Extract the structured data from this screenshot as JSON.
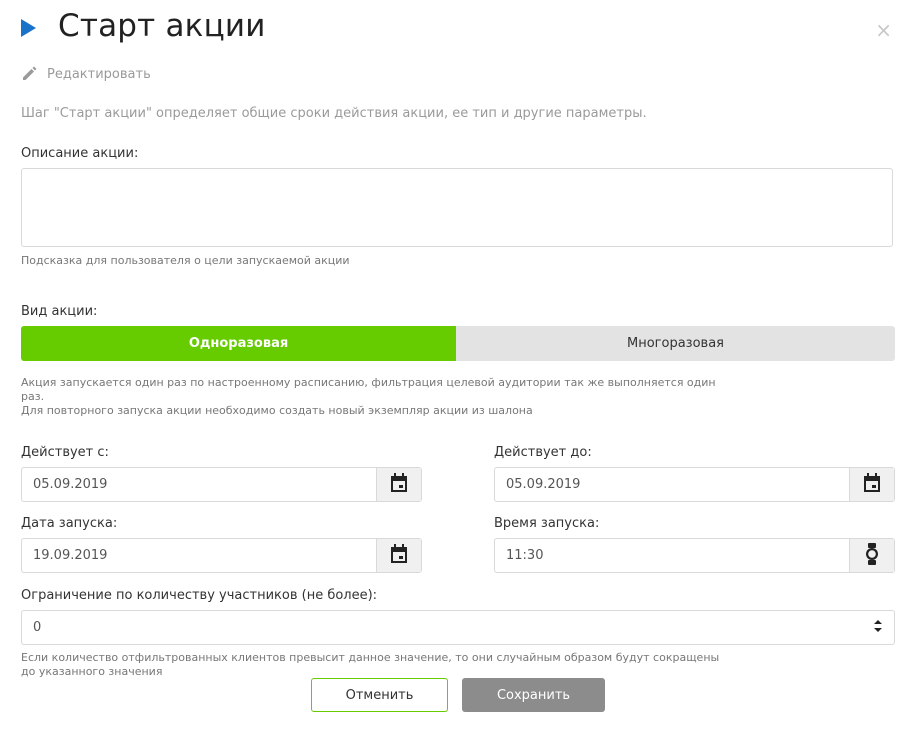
{
  "header": {
    "title": "Старт акции",
    "close": "×"
  },
  "edit": {
    "label": "Редактировать"
  },
  "intro": "Шаг \"Старт акции\" определяет общие сроки действия акции, ее тип и другие параметры.",
  "description": {
    "label": "Описание акции:",
    "value": "",
    "hint": "Подсказка для пользователя о цели запускаемой акции"
  },
  "type": {
    "label": "Вид акции:",
    "options": [
      "Одноразовая",
      "Многоразовая"
    ],
    "selected": "Одноразовая",
    "hint_line1": "Акция запускается один раз по настроенному расписанию, фильтрация целевой аудитории так же выполняется один",
    "hint_line2": "раз.",
    "hint_line3": "Для повторного запуска акции необходимо создать новый экземпляр акции из шалона"
  },
  "dates": {
    "from_label": "Действует с:",
    "from_value": "05.09.2019",
    "to_label": "Действует до:",
    "to_value": "05.09.2019",
    "launch_date_label": "Дата запуска:",
    "launch_date_value": "19.09.2019",
    "launch_time_label": "Время запуска:",
    "launch_time_value": "11:30"
  },
  "limit": {
    "label": "Ограничение по количеству участников (не более):",
    "value": "0",
    "hint_line1": "Если количество отфильтрованных клиентов превысит данное значение, то они случайным образом будут сокращены",
    "hint_line2": "до указанного значения"
  },
  "actions": {
    "cancel": "Отменить",
    "save": "Сохранить"
  },
  "colors": {
    "accent_green": "#66cc00",
    "header_arrow": "#1a73c8",
    "save_disabled": "#8c8c8c"
  },
  "icons": [
    "play-arrow-icon",
    "close-icon",
    "pencil-icon",
    "calendar-icon",
    "watch-icon",
    "stepper-icon"
  ]
}
